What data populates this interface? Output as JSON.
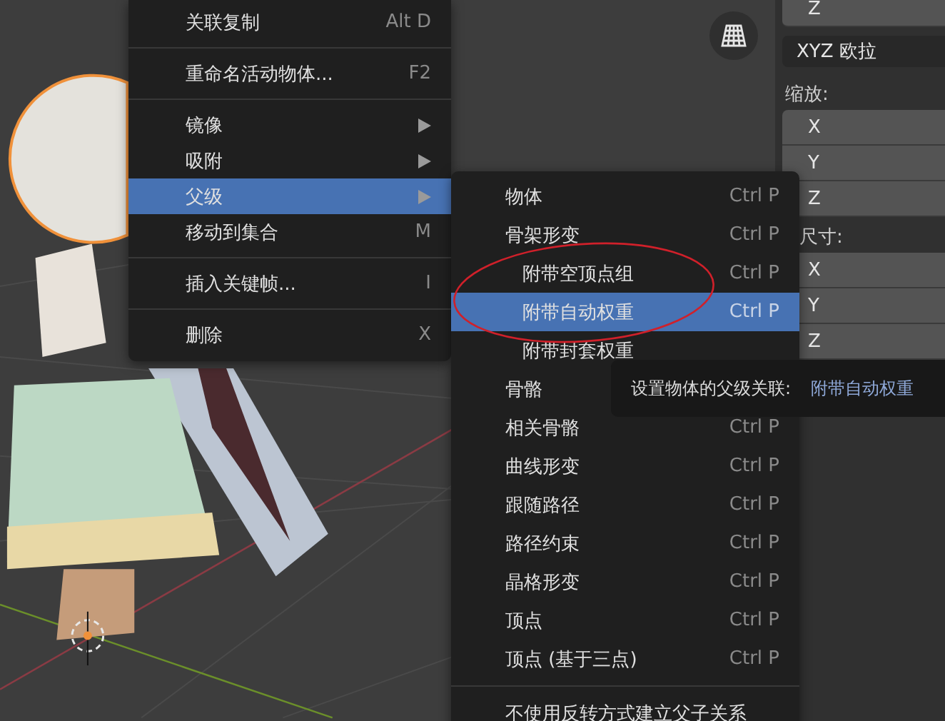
{
  "main_menu": {
    "items": [
      {
        "kind": "item",
        "label": "关联复制",
        "shortcut": "Alt D",
        "submenu": false,
        "selected": false
      },
      {
        "kind": "separator"
      },
      {
        "kind": "item",
        "label": "重命名活动物体...",
        "shortcut": "F2",
        "submenu": false,
        "selected": false
      },
      {
        "kind": "separator"
      },
      {
        "kind": "item",
        "label": "镜像",
        "submenu": true,
        "selected": false
      },
      {
        "kind": "item",
        "label": "吸附",
        "submenu": true,
        "selected": false
      },
      {
        "kind": "item",
        "label": "父级",
        "submenu": true,
        "selected": true
      },
      {
        "kind": "item",
        "label": "移动到集合",
        "shortcut": "M",
        "submenu": false,
        "selected": false
      },
      {
        "kind": "separator"
      },
      {
        "kind": "item",
        "label": "插入关键帧...",
        "shortcut": "I",
        "submenu": false,
        "selected": false
      },
      {
        "kind": "separator"
      },
      {
        "kind": "item",
        "label": "删除",
        "shortcut": "X",
        "submenu": false,
        "selected": false
      }
    ]
  },
  "parent_submenu": {
    "items": [
      {
        "kind": "item",
        "label": "物体",
        "shortcut": "Ctrl P",
        "selected": false
      },
      {
        "kind": "item",
        "label": "骨架形变",
        "shortcut": "Ctrl P",
        "selected": false,
        "children": [
          {
            "kind": "item",
            "label": "附带空顶点组",
            "shortcut": "Ctrl P",
            "selected": false
          },
          {
            "kind": "item",
            "label": "附带自动权重",
            "shortcut": "Ctrl P",
            "selected": true
          },
          {
            "kind": "item",
            "label": "附带封套权重",
            "selected": false
          }
        ]
      },
      {
        "kind": "item",
        "label": "骨骼",
        "selected": false
      },
      {
        "kind": "item",
        "label": "相关骨骼",
        "shortcut": "Ctrl P",
        "selected": false
      },
      {
        "kind": "item",
        "label": "曲线形变",
        "shortcut": "Ctrl P",
        "selected": false
      },
      {
        "kind": "item",
        "label": "跟随路径",
        "shortcut": "Ctrl P",
        "selected": false
      },
      {
        "kind": "item",
        "label": "路径约束",
        "shortcut": "Ctrl P",
        "selected": false
      },
      {
        "kind": "item",
        "label": "晶格形变",
        "shortcut": "Ctrl P",
        "selected": false
      },
      {
        "kind": "item",
        "label": "顶点",
        "shortcut": "Ctrl P",
        "selected": false
      },
      {
        "kind": "item",
        "label": "顶点 (基于三点)",
        "shortcut": "Ctrl P",
        "selected": false
      },
      {
        "kind": "separator"
      },
      {
        "kind": "item",
        "label": "不使用反转方式建立父子关系",
        "selected": false
      }
    ]
  },
  "tooltip": {
    "text": "设置物体的父级关联:",
    "value": "附带自动权重"
  },
  "properties": {
    "rotation_fields": [
      "Z"
    ],
    "rotation_mode": "XYZ 欧拉",
    "scale_label": "缩放:",
    "scale_fields": [
      "X",
      "Y",
      "Z"
    ],
    "dimensions_label": "尺寸:",
    "dimension_fields": [
      "X",
      "Y",
      "Z"
    ]
  }
}
